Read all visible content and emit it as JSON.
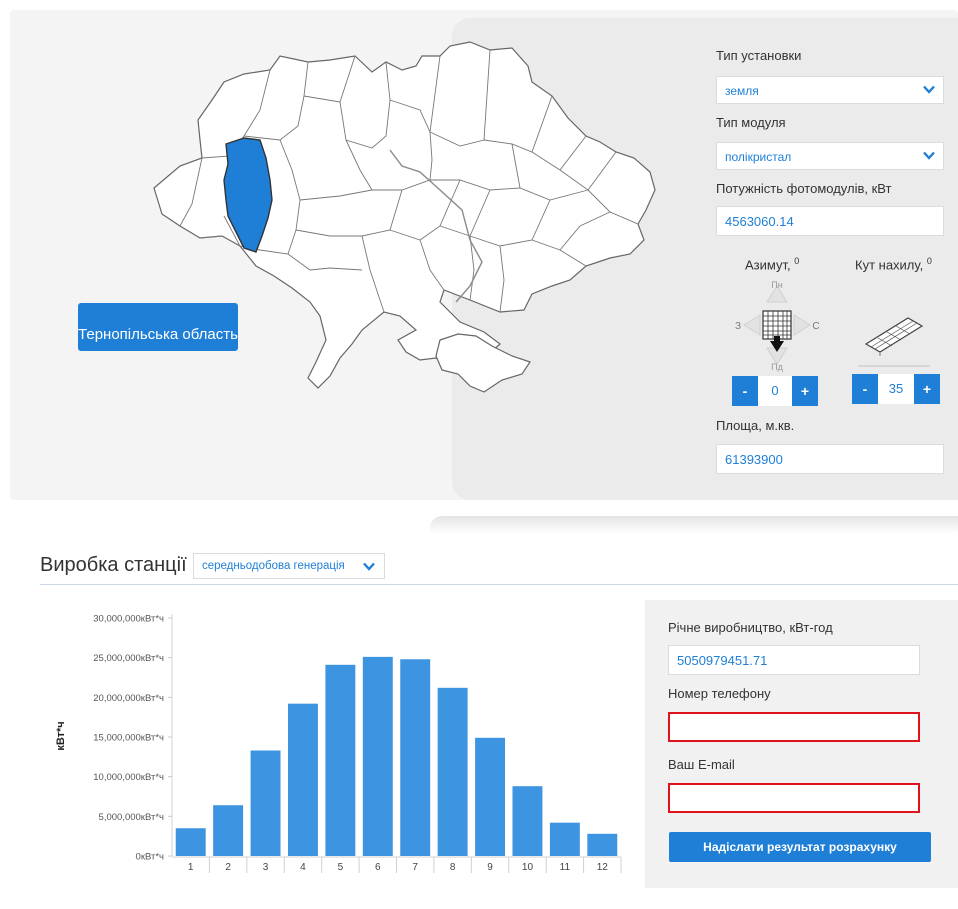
{
  "map": {
    "selected_region": "Тернопільська область",
    "highlight_color": "#1f7fd6"
  },
  "form": {
    "install_type_label": "Тип установки",
    "install_type_value": "земля",
    "module_type_label": "Тип модуля",
    "module_type_value": "полікристал",
    "power_label": "Потужність фотомодулів, кВт",
    "power_value": "4563060.14",
    "azimuth_label": "Азимут,",
    "tilt_label": "Кут нахилу,",
    "degree_mark": "0",
    "compass": {
      "north": "Пн",
      "south": "Пд",
      "west": "З",
      "east": "С"
    },
    "azimuth_value": "0",
    "tilt_value": "35",
    "minus_label": "-",
    "plus_label": "+",
    "area_label": "Площа, м.кв.",
    "area_value": "61393900"
  },
  "production": {
    "title": "Виробка станції",
    "mode_value": "середньодобова генерація"
  },
  "results": {
    "annual_label": "Річне виробництво, кВт-год",
    "annual_value": "5050979451.71",
    "phone_label": "Номер телефону",
    "phone_value": "",
    "email_label": "Ваш E-mail",
    "email_value": "",
    "send_label": "Надіслати результат розрахунку"
  },
  "colors": {
    "accent": "#1f7fd6",
    "bar": "#3d94e0",
    "error_border": "#e0121b"
  },
  "chart_data": {
    "type": "bar",
    "categories": [
      "1",
      "2",
      "3",
      "4",
      "5",
      "6",
      "7",
      "8",
      "9",
      "10",
      "11",
      "12"
    ],
    "values": [
      3500000,
      6400000,
      13300000,
      19200000,
      24100000,
      25100000,
      24800000,
      21200000,
      14900000,
      8800000,
      4200000,
      2800000
    ],
    "ylabel": "кВт*ч",
    "y_unit": "кВт*ч",
    "yticks": [
      0,
      5000000,
      10000000,
      15000000,
      20000000,
      25000000,
      30000000
    ],
    "ylim": [
      0,
      30000000
    ]
  }
}
